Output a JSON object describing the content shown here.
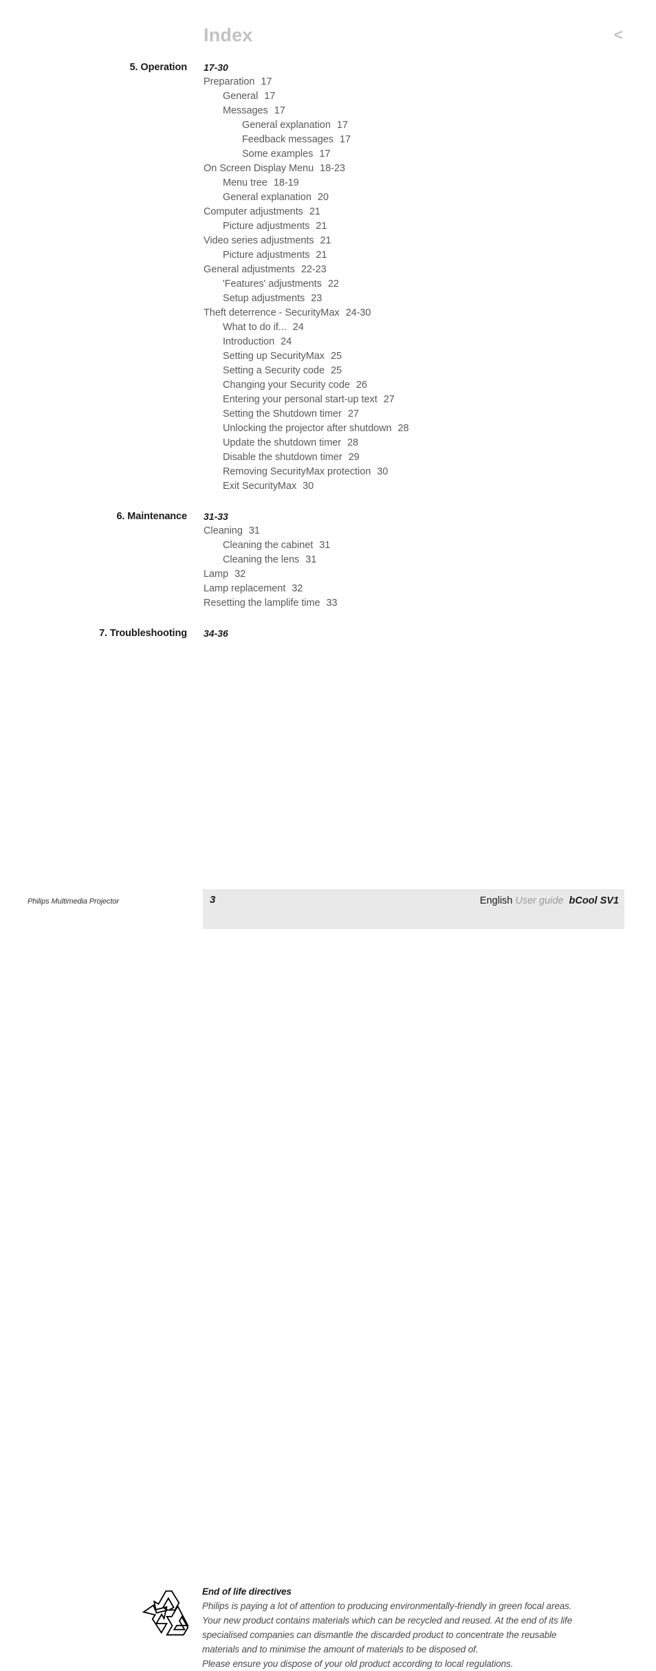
{
  "header": {
    "title": "Index",
    "back_marker": "<"
  },
  "toc": {
    "sections": [
      {
        "title": "5. Operation",
        "pages": "17-30",
        "entries": [
          {
            "level": 1,
            "label": "Preparation",
            "pages": "17"
          },
          {
            "level": 2,
            "label": "General",
            "pages": "17"
          },
          {
            "level": 2,
            "label": "Messages",
            "pages": "17"
          },
          {
            "level": 3,
            "label": "General explanation",
            "pages": "17"
          },
          {
            "level": 3,
            "label": "Feedback messages",
            "pages": "17"
          },
          {
            "level": 3,
            "label": "Some examples",
            "pages": "17"
          },
          {
            "level": 1,
            "label": "On Screen Display Menu",
            "pages": "18-23"
          },
          {
            "level": 2,
            "label": "Menu tree",
            "pages": "18-19"
          },
          {
            "level": 2,
            "label": "General explanation",
            "pages": "20"
          },
          {
            "level": 1,
            "label": "Computer adjustments",
            "pages": "21"
          },
          {
            "level": 2,
            "label": "Picture adjustments",
            "pages": "21"
          },
          {
            "level": 1,
            "label": "Video series adjustments",
            "pages": "21"
          },
          {
            "level": 2,
            "label": "Picture adjustments",
            "pages": "21"
          },
          {
            "level": 1,
            "label": "General adjustments",
            "pages": "22-23"
          },
          {
            "level": 2,
            "label": "'Features' adjustments",
            "pages": "22"
          },
          {
            "level": 2,
            "label": "Setup adjustments",
            "pages": "23"
          },
          {
            "level": 1,
            "label": "Theft deterrence - SecurityMax",
            "pages": "24-30"
          },
          {
            "level": 2,
            "label": "What to do if...",
            "pages": "24"
          },
          {
            "level": 2,
            "label": "Introduction",
            "pages": "24"
          },
          {
            "level": 2,
            "label": "Setting up SecurityMax",
            "pages": "25"
          },
          {
            "level": 2,
            "label": "Setting a Security code",
            "pages": "25"
          },
          {
            "level": 2,
            "label": "Changing your Security code",
            "pages": "26"
          },
          {
            "level": 2,
            "label": "Entering your personal start-up text",
            "pages": "27"
          },
          {
            "level": 2,
            "label": "Setting the Shutdown timer",
            "pages": "27"
          },
          {
            "level": 2,
            "label": "Unlocking the projector after shutdown",
            "pages": "28"
          },
          {
            "level": 2,
            "label": "Update the shutdown timer",
            "pages": "28"
          },
          {
            "level": 2,
            "label": "Disable the shutdown timer",
            "pages": "29"
          },
          {
            "level": 2,
            "label": "Removing SecurityMax protection",
            "pages": "30"
          },
          {
            "level": 2,
            "label": "Exit SecurityMax",
            "pages": "30"
          }
        ]
      },
      {
        "title": "6. Maintenance",
        "pages": "31-33",
        "entries": [
          {
            "level": 1,
            "label": "Cleaning",
            "pages": "31"
          },
          {
            "level": 2,
            "label": "Cleaning the cabinet",
            "pages": "31"
          },
          {
            "level": 2,
            "label": "Cleaning the lens",
            "pages": "31"
          },
          {
            "level": 1,
            "label": "Lamp",
            "pages": "32"
          },
          {
            "level": 1,
            "label": "Lamp replacement",
            "pages": "32"
          },
          {
            "level": 1,
            "label": "Resetting the lamplife time",
            "pages": "33"
          }
        ]
      },
      {
        "title": "7. Troubleshooting",
        "pages": "34-36",
        "entries": []
      }
    ]
  },
  "end_of_life": {
    "icon": "recycle-icon",
    "heading": "End of life directives",
    "lines": [
      "Philips is paying a lot of attention to producing environmentally-friendly in green focal areas.",
      "Your new product contains materials which can be recycled and reused. At the end of its life",
      "specialised companies can dismantle the discarded product to concentrate the reusable",
      "materials and to minimise the amount of materials to be disposed of.",
      "Please ensure you dispose of your old product according to local regulations."
    ]
  },
  "footer": {
    "left_text": "Philips Multimedia Projector",
    "page_number": "3",
    "language": "English",
    "guide_label": "User guide",
    "model": "bCool SV1",
    "band_color": "#e9e9e9"
  }
}
